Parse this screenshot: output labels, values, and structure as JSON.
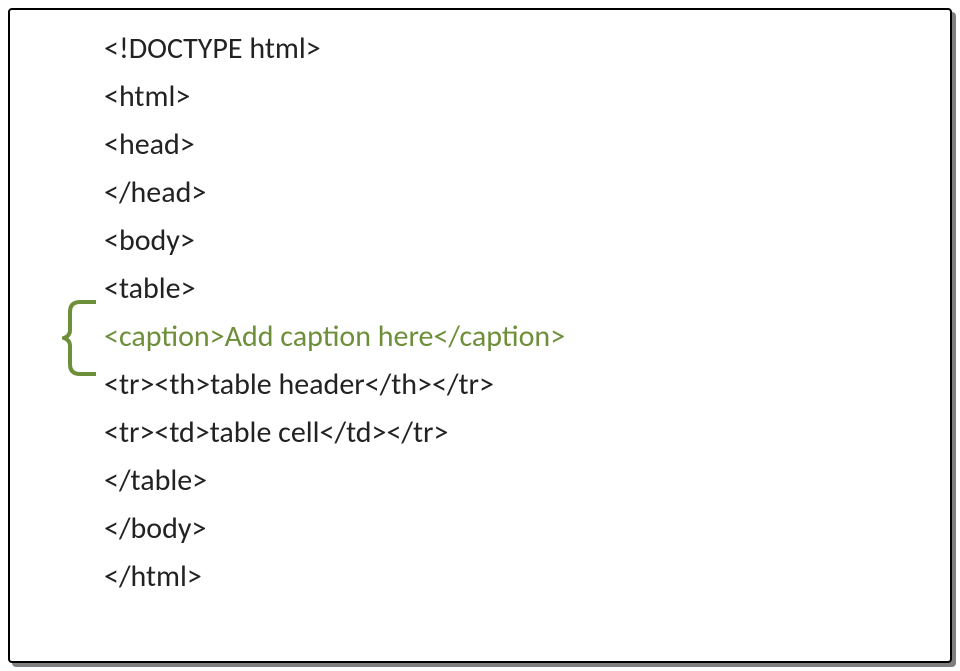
{
  "code": {
    "line1": "<!DOCTYPE html>",
    "line2": "<html>",
    "line3": "<head>",
    "line4": "</head>",
    "line5": "<body>",
    "line6": "<table>",
    "line7": "<caption>Add caption here</caption>",
    "line8": "<tr><th>table header</th></tr>",
    "line9": "<tr><td>table cell</td></tr>",
    "line10": "</table>",
    "line11": "</body>",
    "line12": "</html>"
  }
}
